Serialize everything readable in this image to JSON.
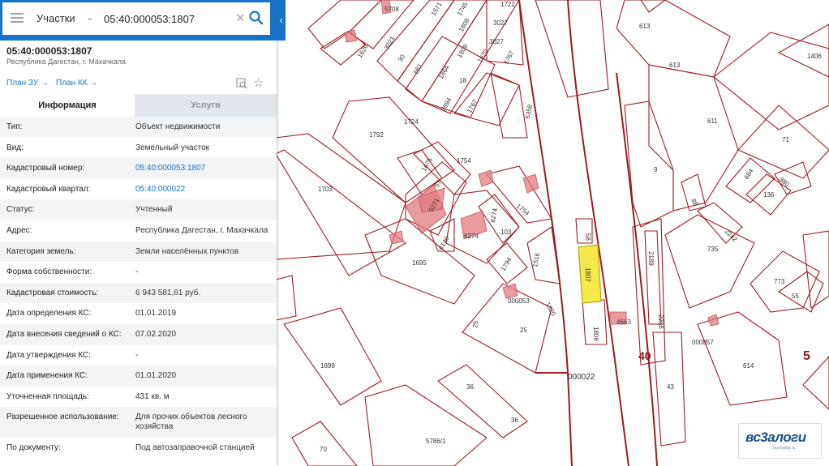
{
  "search": {
    "type_label": "Участки",
    "query": "05:40:000053:1807"
  },
  "object": {
    "title": "05:40:000053:1807",
    "address": "Республика Дагестан, г. Махачкала",
    "plan_zu": "План ЗУ →",
    "plan_kk": "План КК →"
  },
  "tabs": {
    "info": "Информация",
    "services": "Услуги"
  },
  "rows": [
    {
      "k": "Тип:",
      "v": "Объект недвижимости"
    },
    {
      "k": "Вид:",
      "v": "Земельный участок"
    },
    {
      "k": "Кадастровый номер:",
      "v": "05:40:000053:1807"
    },
    {
      "k": "Кадастровый квартал:",
      "v": "05:40:000022"
    },
    {
      "k": "Статус:",
      "v": "Учтенный"
    },
    {
      "k": "Адрес:",
      "v": "Республика Дагестан, г. Махачкала"
    },
    {
      "k": "Категория земель:",
      "v": "Земли населённых пунктов"
    },
    {
      "k": "Форма собственности:",
      "v": "-"
    },
    {
      "k": "Кадастровая стоимость:",
      "v": "6 943 581,61 руб."
    },
    {
      "k": "Дата определения КС:",
      "v": "01.01.2019"
    },
    {
      "k": "Дата внесения сведений о КС:",
      "v": "07.02.2020"
    },
    {
      "k": "Дата утверждения КС:",
      "v": "-"
    },
    {
      "k": "Дата применения КС:",
      "v": "01.01.2020"
    },
    {
      "k": "Уточненная площадь:",
      "v": "431 кв. м"
    },
    {
      "k": "Разрешенное использование:",
      "v": "Для прочих объектов лесного хозяйства"
    },
    {
      "k": "По документу:",
      "v": "Под автозаправочной станцией"
    }
  ],
  "map": {
    "labels": [
      "5708",
      "1571",
      "1745",
      "1722",
      "613",
      "613",
      "1406",
      "3021",
      "1809",
      "1809",
      "3027",
      "3027",
      "1626",
      "30",
      "661",
      "1864",
      "1670",
      "1767",
      "18",
      "3894",
      "1767",
      "5358",
      "611",
      "1792",
      "1724",
      "1754",
      "71",
      "9",
      "684",
      "380",
      "136",
      "1703",
      "1675",
      "57",
      "5271",
      "1754",
      "6274",
      "6274",
      "88",
      "2242",
      "6140",
      "103",
      "58",
      "735",
      "1695",
      "1794",
      "1516",
      "1807",
      "2189",
      "773",
      "55",
      "000053",
      "1520",
      "25",
      "25",
      "2236",
      "4663",
      "1808",
      "000057",
      "40",
      "5",
      "1699",
      "614",
      "000022",
      "36",
      "36",
      "43",
      "5786/1",
      "70"
    ],
    "logo": "вс3алоги",
    "logo_sub": "bcenalogi.ru"
  }
}
